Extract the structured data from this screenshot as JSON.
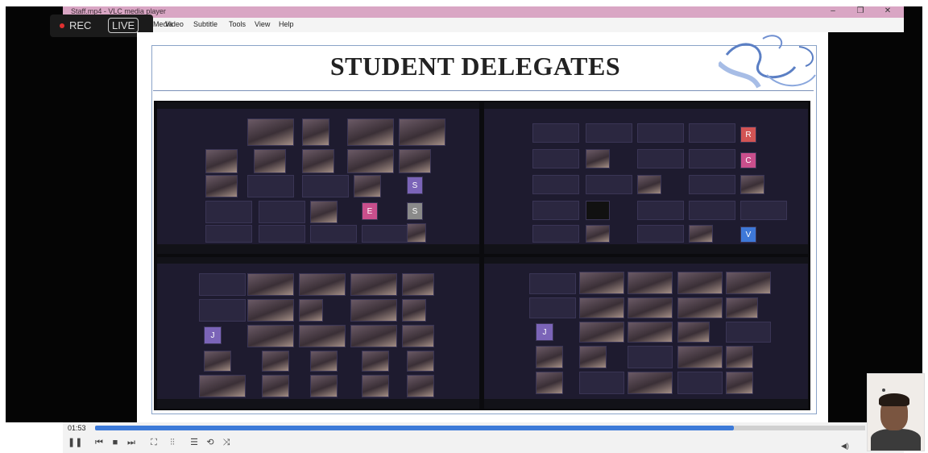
{
  "window": {
    "title": "Staff.mp4 - VLC media player",
    "controls": [
      "–",
      "❐",
      "✕"
    ]
  },
  "menu": [
    "Media",
    "Video",
    "Subtitle",
    "Tools",
    "View",
    "Help"
  ],
  "recording": {
    "rec_label": "REC",
    "live_label": "LIVE",
    "rec_color": "#e03030"
  },
  "slide": {
    "title": "STUDENT DELEGATES"
  },
  "player": {
    "time": "01:53",
    "progress_fraction": 0.83,
    "accent": "#3d7ad8",
    "buttons": [
      "pause-icon",
      "previous-icon",
      "stop-icon",
      "next-icon",
      "fullscreen-icon",
      "extended-settings-icon",
      "playlist-icon",
      "loop-icon",
      "shuffle-icon"
    ],
    "button_glyphs": [
      "❚❚",
      "⏮",
      "■",
      "⏭",
      "⛶",
      "⫶⫶",
      "☰",
      "⟲",
      "⤨"
    ]
  },
  "zoom_letters": [
    "S",
    "E",
    "S",
    "R",
    "C",
    "V",
    "J",
    "J"
  ]
}
